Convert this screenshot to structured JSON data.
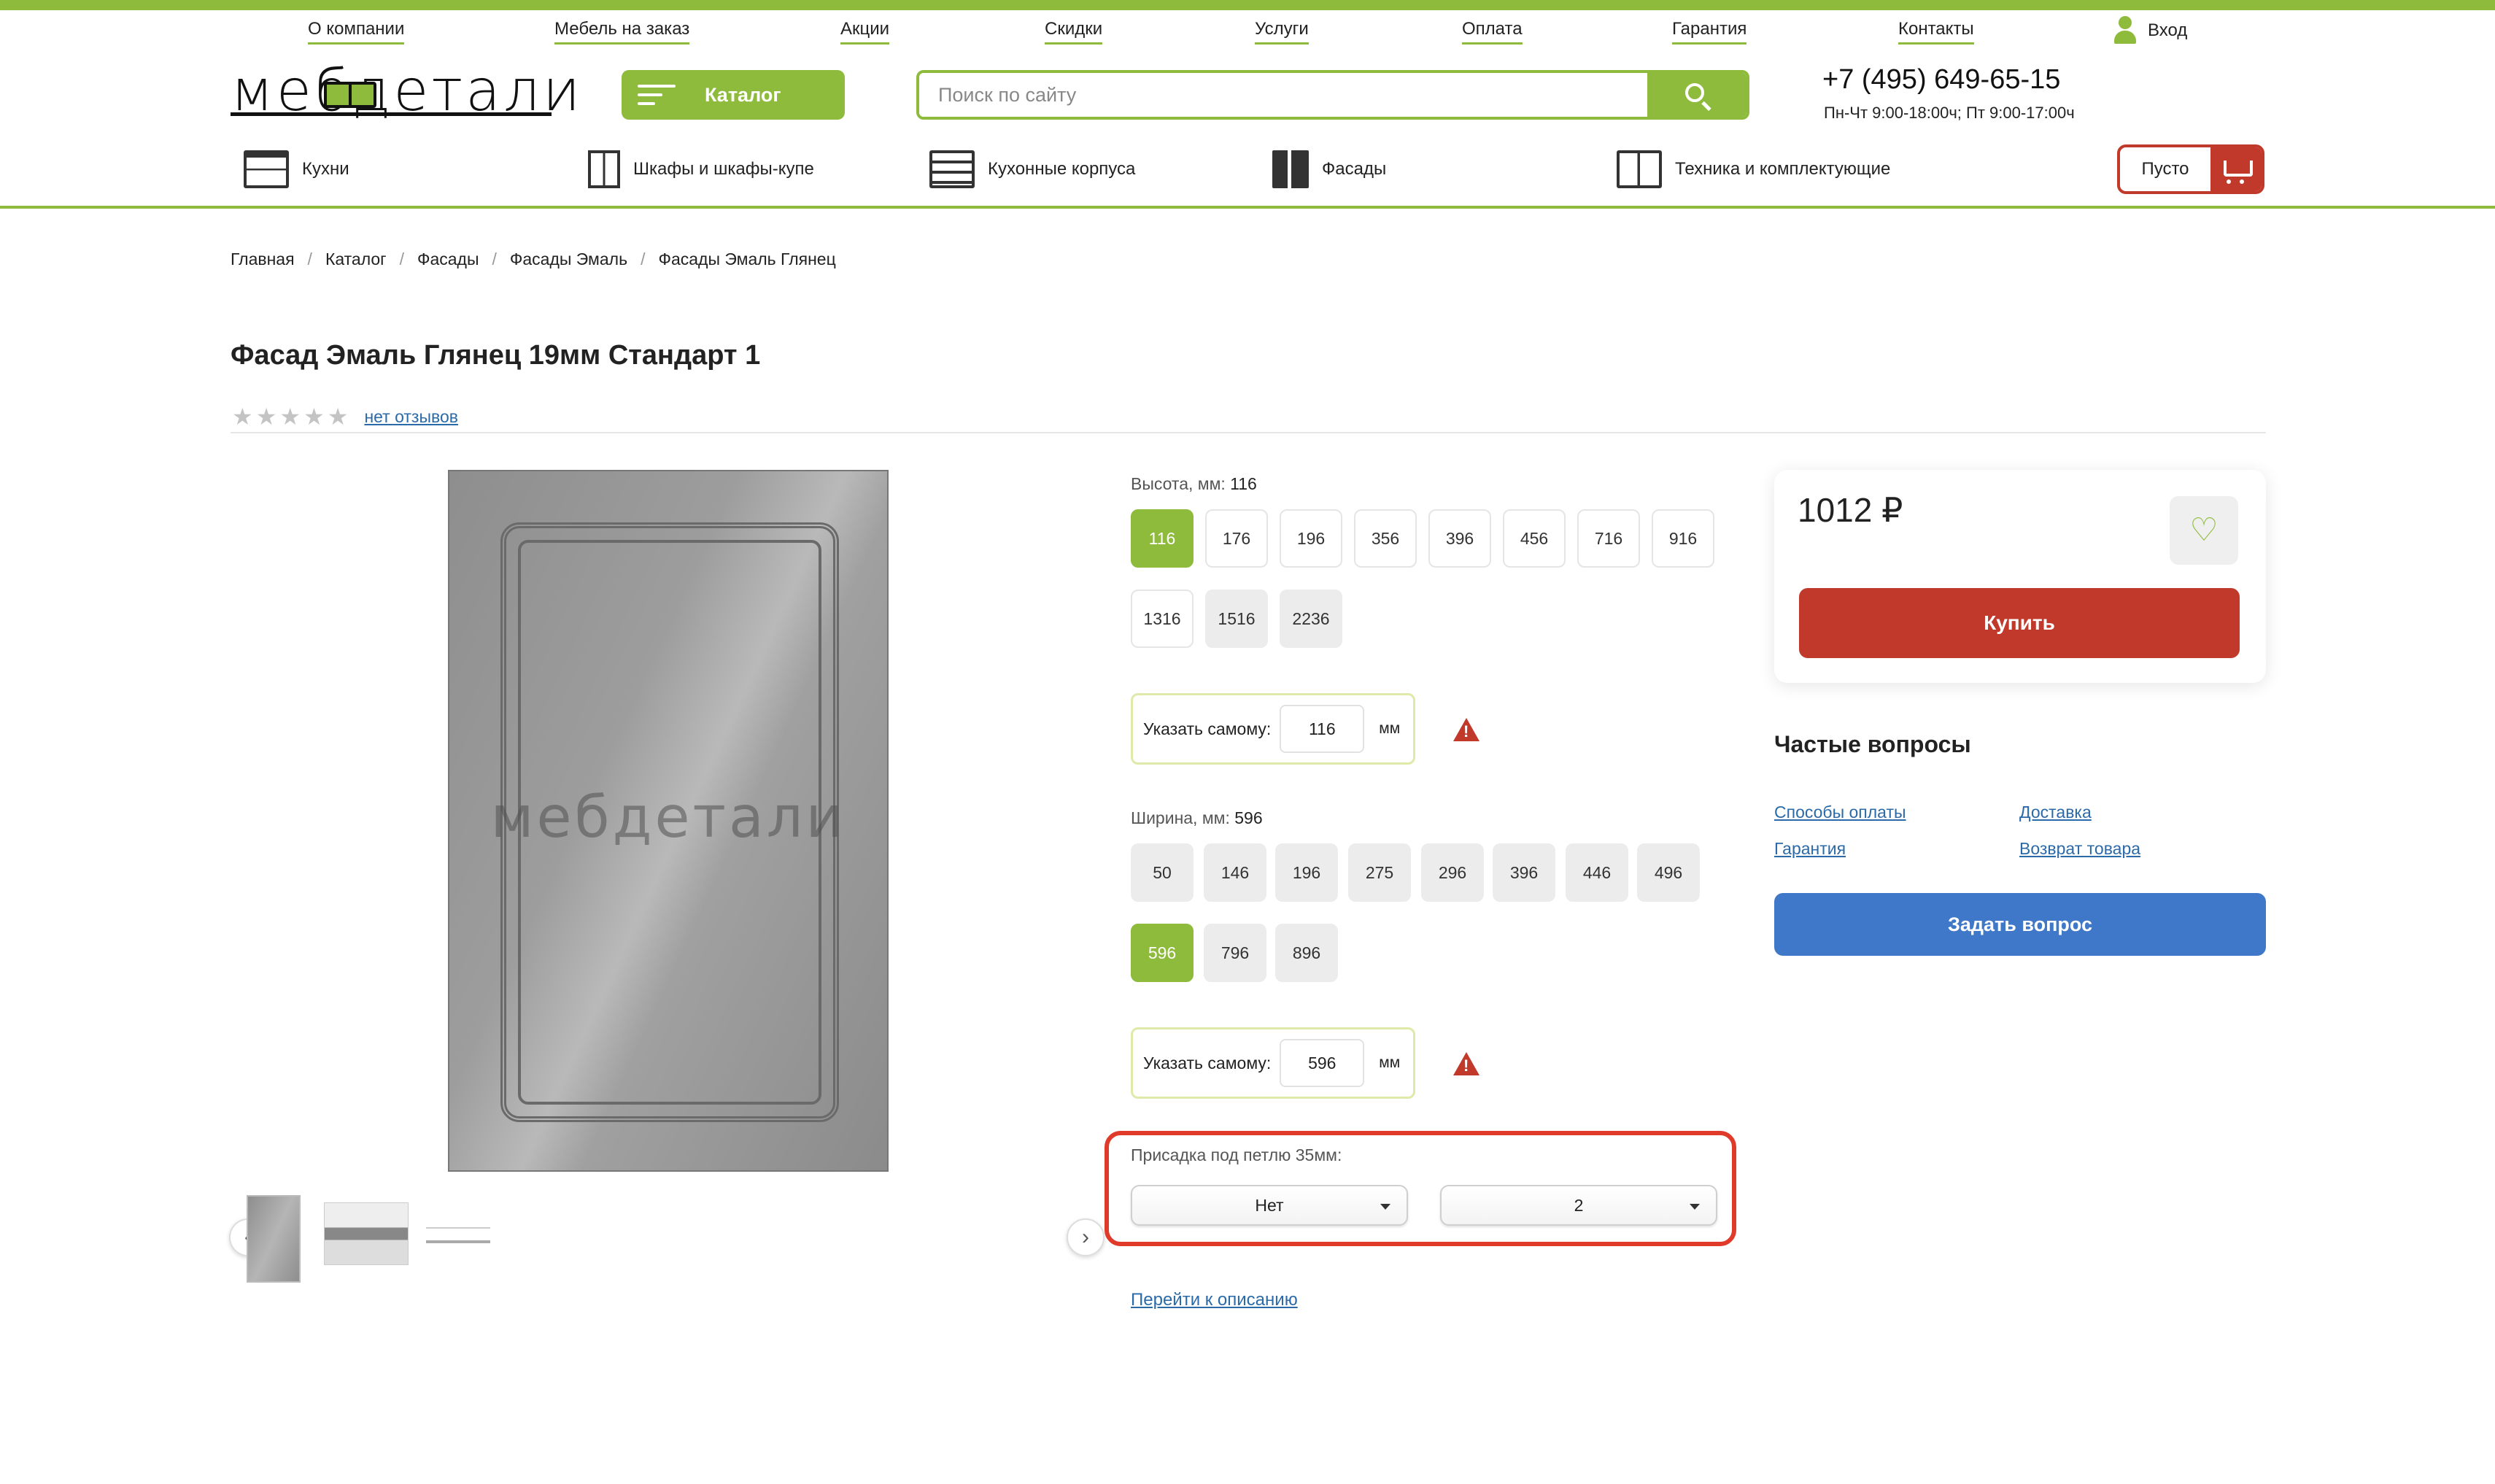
{
  "topnav": {
    "items": [
      "О компании",
      "Мебель на заказ",
      "Акции",
      "Скидки",
      "Услуги",
      "Оплата",
      "Гарантия",
      "Контакты"
    ],
    "login_label": "Вход"
  },
  "header": {
    "logo_text": "мебдетали",
    "catalog_label": "Каталог",
    "search_placeholder": "Поиск по сайту",
    "phone": "+7 (495) 649-65-15",
    "hours": "Пн-Чт 9:00-18:00ч; Пт 9:00-17:00ч",
    "cart_label": "Пусто"
  },
  "categories": [
    {
      "label": "Кухни",
      "icon": "kitchen-icon"
    },
    {
      "label": "Шкафы и шкафы-купе",
      "icon": "wardrobe-icon"
    },
    {
      "label": "Кухонные корпуса",
      "icon": "cabinet-icon"
    },
    {
      "label": "Фасады",
      "icon": "facade-icon"
    },
    {
      "label": "Техника и комплектующие",
      "icon": "appliance-icon"
    }
  ],
  "breadcrumb": [
    "Главная",
    "Каталог",
    "Фасады",
    "Фасады Эмаль",
    "Фасады Эмаль Глянец"
  ],
  "product": {
    "title": "Фасад Эмаль Глянец 19мм Стандарт 1",
    "rating": 0,
    "reviews_link": "нет отзывов",
    "watermark": "мебдетали"
  },
  "options": {
    "height": {
      "label": "Высота, мм:",
      "selected": "116",
      "values": [
        "116",
        "176",
        "196",
        "356",
        "396",
        "456",
        "716",
        "916",
        "1316",
        "1516",
        "2236"
      ],
      "custom_label": "Указать самому:",
      "custom_value": "116",
      "unit": "мм"
    },
    "width": {
      "label": "Ширина, мм:",
      "selected": "596",
      "values": [
        "50",
        "146",
        "196",
        "275",
        "296",
        "396",
        "446",
        "496",
        "596",
        "796",
        "896"
      ],
      "custom_label": "Указать самому:",
      "custom_value": "596",
      "unit": "мм"
    },
    "hinge": {
      "label": "Присадка под петлю 35мм:",
      "select1": "Нет",
      "select2": "2"
    },
    "desc_link": "Перейти к описанию"
  },
  "buy": {
    "price": "1012 ₽",
    "buy_label": "Купить"
  },
  "faq": {
    "title": "Частые вопросы",
    "links": [
      "Способы оплаты",
      "Доставка",
      "Гарантия",
      "Возврат товара"
    ],
    "ask_label": "Задать вопрос"
  },
  "colors": {
    "accent": "#8fbb3c",
    "buy": "#c0392b",
    "ask": "#3f78c8",
    "link": "#2b6aa8"
  }
}
